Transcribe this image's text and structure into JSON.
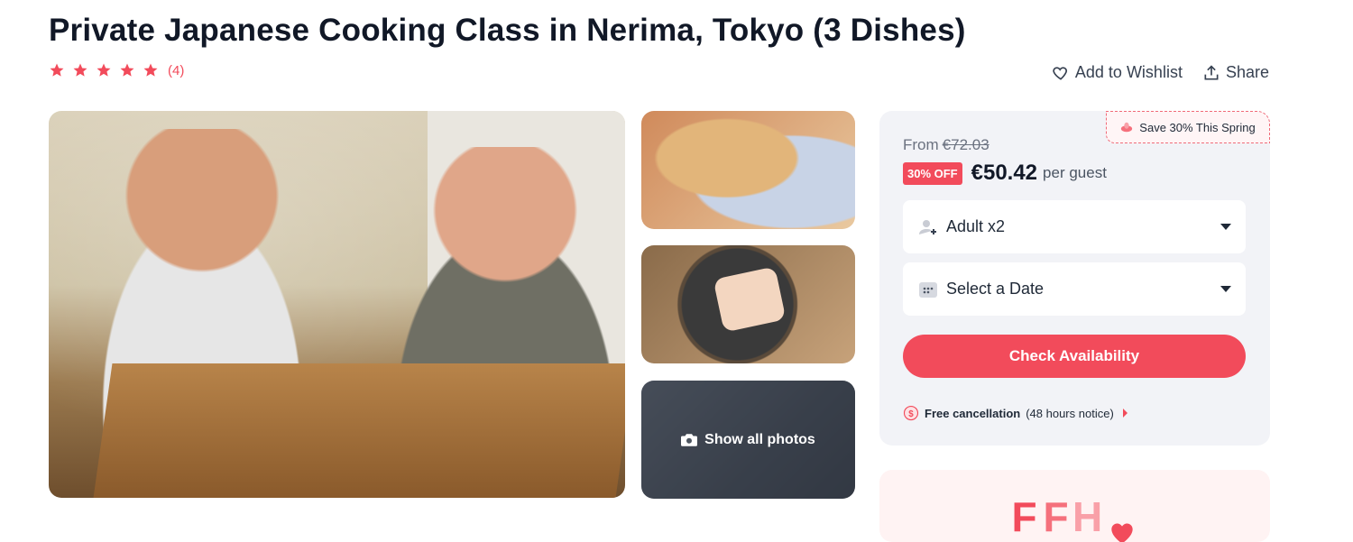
{
  "title": "Private Japanese Cooking Class in Nerima, Tokyo (3 Dishes)",
  "rating": {
    "stars": 5,
    "count": "(4)",
    "star_color": "#f24b5b"
  },
  "actions": {
    "wishlist": "Add to Wishlist",
    "share": "Share"
  },
  "gallery": {
    "show_all": "Show all photos"
  },
  "booking": {
    "promo": "Save 30% This Spring",
    "from_label": "From",
    "old_price": "€72.03",
    "discount": "30% OFF",
    "price": "€50.42",
    "per": "per guest",
    "guests": "Adult x2",
    "date_placeholder": "Select a Date",
    "check_button": "Check Availability",
    "cancel_bold": "Free cancellation",
    "cancel_note": "(48 hours notice)"
  },
  "promo_logo": {
    "letters": [
      "F",
      "F",
      "H"
    ]
  },
  "colors": {
    "accent": "#f24b5b",
    "panel": "#f2f3f7",
    "text": "#111827"
  }
}
